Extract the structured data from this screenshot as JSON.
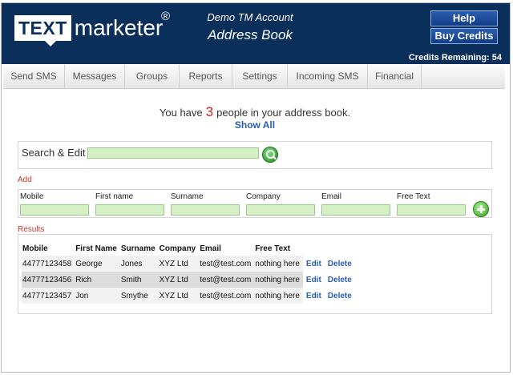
{
  "header": {
    "logo_box": "TEXT",
    "logo_rest": "marketer",
    "logo_reg": "®",
    "account_name": "Demo TM Account",
    "page_title": "Address Book",
    "help_label": "Help",
    "buy_credits_label": "Buy Credits",
    "credits_text": "Credits Remaining: 54"
  },
  "nav": {
    "items": [
      {
        "label": "Send SMS"
      },
      {
        "label": "Messages"
      },
      {
        "label": "Groups"
      },
      {
        "label": "Reports"
      },
      {
        "label": "Settings"
      },
      {
        "label": "Incoming SMS"
      },
      {
        "label": "Financial"
      }
    ]
  },
  "summary": {
    "prefix": "You have",
    "count": "3",
    "suffix": "people in your address book.",
    "show_all": "Show All"
  },
  "search": {
    "label": "Search & Edit",
    "value": "",
    "button_icon": "search-icon"
  },
  "add": {
    "section_label": "Add",
    "fields": [
      {
        "label": "Mobile",
        "value": ""
      },
      {
        "label": "First name",
        "value": ""
      },
      {
        "label": "Surname",
        "value": ""
      },
      {
        "label": "Company",
        "value": ""
      },
      {
        "label": "Email",
        "value": ""
      },
      {
        "label": "Free Text",
        "value": ""
      }
    ],
    "button_icon": "plus-icon"
  },
  "results": {
    "section_label": "Results",
    "columns": [
      "Mobile",
      "First Name",
      "Surname",
      "Company",
      "Email",
      "Free Text"
    ],
    "rows": [
      {
        "mobile": "44777123458",
        "first_name": "George",
        "surname": "Jones",
        "company": "XYZ Ltd",
        "email": "test@test.com",
        "free_text": "nothing here",
        "edit": "Edit",
        "delete": "Delete"
      },
      {
        "mobile": "44777123456",
        "first_name": "Rich",
        "surname": "Smith",
        "company": "XYZ Ltd",
        "email": "test@test.com",
        "free_text": "nothing here",
        "edit": "Edit",
        "delete": "Delete"
      },
      {
        "mobile": "44777123457",
        "first_name": "Jon",
        "surname": "Smythe",
        "company": "XYZ Ltd",
        "email": "test@test.com",
        "free_text": "nothing here",
        "edit": "Edit",
        "delete": "Delete"
      }
    ]
  },
  "colors": {
    "header_bg": "#0b2f5b",
    "input_bg": "#d4f0c4",
    "link": "#2a5db0",
    "label_red": "#d0342c",
    "count_red": "#cc2222"
  }
}
